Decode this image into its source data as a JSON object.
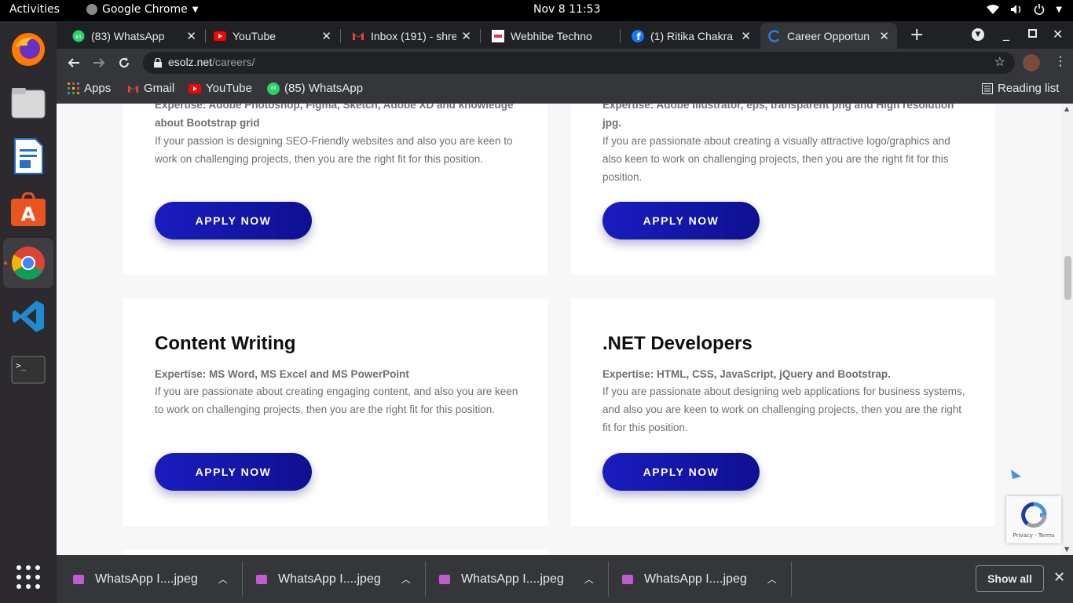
{
  "topbar": {
    "activities": "Activities",
    "app_name": "Google Chrome",
    "clock": "Nov 8  11:53"
  },
  "tabs": [
    {
      "title": "(83) WhatsApp",
      "icon": "whatsapp-icon"
    },
    {
      "title": "YouTube",
      "icon": "youtube-icon"
    },
    {
      "title": "Inbox (191) - shre",
      "icon": "gmail-icon"
    },
    {
      "title": "Webhibe Techno",
      "icon": "webhibe-icon"
    },
    {
      "title": "(1) Ritika Chakra",
      "icon": "facebook-icon"
    },
    {
      "title": "Career Opportun",
      "icon": "esolz-icon"
    }
  ],
  "omnibox": {
    "domain": "esolz.net",
    "path": "/careers/"
  },
  "bookmarks": {
    "apps": "Apps",
    "gmail": "Gmail",
    "youtube": "YouTube",
    "whatsapp": "(85) WhatsApp",
    "whatsapp_badge": "83",
    "reading_list": "Reading list"
  },
  "cards": [
    {
      "title": "",
      "expertise": "Expertise: Adobe Photoshop, Figma, Sketch, Adobe XD and knowledge about Bootstrap grid",
      "description": "If your passion is designing SEO-Friendly websites and also you are keen to work on challenging projects, then you are the right fit for this position.",
      "button": "APPLY NOW"
    },
    {
      "title": "",
      "expertise": "Expertise: Adobe Illustrator, eps, transparent png and High resolution jpg.",
      "description": "If you are passionate about creating a visually attractive logo/graphics and also keen to work on challenging projects, then you are the right fit for this position.",
      "button": "APPLY NOW"
    },
    {
      "title": "Content Writing",
      "expertise": "Expertise: MS Word, MS Excel and MS PowerPoint",
      "description": "If you are passionate about creating engaging content, and also you are keen to work on challenging projects, then you are the right fit for this position.",
      "button": "APPLY NOW"
    },
    {
      "title": ".NET Developers",
      "expertise": "Expertise: HTML, CSS, JavaScript, jQuery and Bootstrap.",
      "description": "If you are passionate about designing web applications for business systems, and also you are keen to work on challenging projects, then you are the right fit for this position.",
      "button": "APPLY NOW"
    }
  ],
  "recaptcha": {
    "privacy": "Privacy",
    "terms": "Terms"
  },
  "downloads": {
    "files": [
      "WhatsApp I....jpeg",
      "WhatsApp I....jpeg",
      "WhatsApp I....jpeg",
      "WhatsApp I....jpeg"
    ],
    "show_all": "Show all"
  },
  "colors": {
    "accent": "#1a1cc0",
    "chrome_dark": "#202124",
    "chrome_toolbar": "#35363a"
  }
}
